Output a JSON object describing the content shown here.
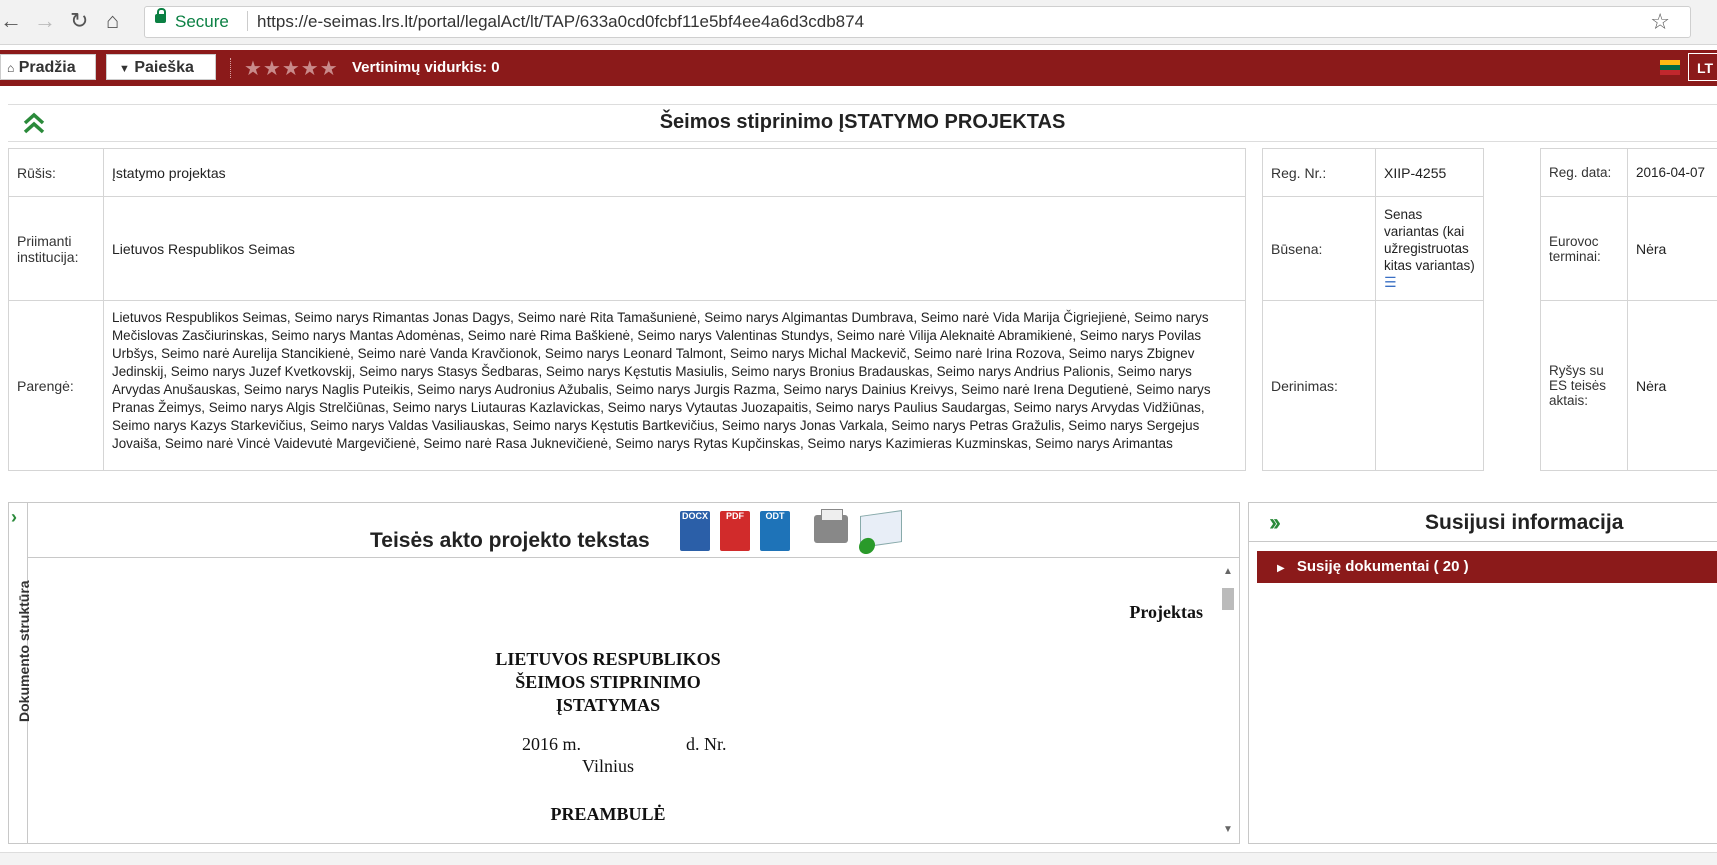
{
  "browser": {
    "secure_label": "Secure",
    "url": "https://e-seimas.lrs.lt/portal/legalAct/lt/TAP/633a0cd0fcbf11e5bf4ee4a6d3cdb874"
  },
  "toolbar": {
    "home_label": "Pradžia",
    "search_label": "Paieška",
    "rating_label": "Vertinimų vidurkis: 0",
    "lang": "LT"
  },
  "page": {
    "title": "Šeimos stiprinimo ĮSTATYMO PROJEKTAS"
  },
  "info": {
    "rusis_label": "Rūšis:",
    "rusis_value": "Įstatymo projektas",
    "priimanti_label": "Priimanti institucija:",
    "priimanti_value": "Lietuvos Respublikos Seimas",
    "parenge_label": "Parengė:",
    "parenge_value": "Lietuvos Respublikos Seimas, Seimo narys Rimantas Jonas Dagys, Seimo narė Rita Tamašunienė, Seimo narys Algimantas Dumbrava, Seimo narė Vida Marija Čigriejienė, Seimo narys Mečislovas Zasčiurinskas, Seimo narys Mantas Adomėnas, Seimo narė Rima Baškienė, Seimo narys Valentinas Stundys, Seimo narė Vilija Aleknaitė Abramikienė, Seimo narys Povilas Urbšys, Seimo narė Aurelija Stancikienė, Seimo narė Vanda Kravčionok, Seimo narys Leonard Talmont, Seimo narys Michal Mackevič, Seimo narė Irina Rozova, Seimo narys Zbignev Jedinskij, Seimo narys Juzef Kvetkovskij, Seimo narys Stasys Šedbaras, Seimo narys Kęstutis Masiulis, Seimo narys Bronius Bradauskas, Seimo narys Andrius Palionis, Seimo narys Arvydas Anušauskas, Seimo narys Naglis Puteikis, Seimo narys Audronius Ažubalis, Seimo narys Jurgis Razma, Seimo narys Dainius Kreivys, Seimo narė Irena Degutienė, Seimo narys Pranas Žeimys, Seimo narys Algis Strelčiūnas, Seimo narys Liutauras Kazlavickas, Seimo narys Vytautas Juozapaitis, Seimo narys Paulius Saudargas, Seimo narys Arvydas Vidžiūnas, Seimo narys Kazys Starkevičius, Seimo narys Valdas Vasiliauskas, Seimo narys Kęstutis Bartkevičius, Seimo narys Jonas Varkala, Seimo narys Petras Gražulis, Seimo narys Sergejus Jovaiša, Seimo narė Vincė Vaidevutė Margevičienė, Seimo narė Rasa Juknevičienė, Seimo narys Rytas Kupčinskas, Seimo narys Kazimieras Kuzminskas, Seimo narys Arimantas",
    "reg_nr_label": "Reg. Nr.:",
    "reg_nr_value": "XIIP-4255",
    "busena_label": "Būsena:",
    "busena_value": "Senas variantas (kai užregistruotas kitas variantas)",
    "derinimas_label": "Derinimas:",
    "reg_data_label": "Reg. data:",
    "reg_data_value": "2016-04-07",
    "eurovoc_label": "Eurovoc terminai:",
    "eurovoc_value": "Nėra",
    "rysys_label": "Ryšys su ES teisės aktais:",
    "rysys_value": "Nėra"
  },
  "doc": {
    "side_label": "Dokumento struktūra",
    "title": "Teisės akto projekto tekstas",
    "formats": [
      "DOCX",
      "PDF",
      "ODT"
    ],
    "projektas": "Projektas",
    "heading1": "LIETUVOS RESPUBLIKOS",
    "heading2": "ŠEIMOS STIPRINIMO",
    "heading3": "ĮSTATYMAS",
    "date_year": "2016 m.",
    "date_nr": "d. Nr.",
    "city": "Vilnius",
    "preamble": "PREAMBULĖ"
  },
  "related": {
    "title": "Susijusi informacija",
    "documents_label": "Susiję dokumentai ( 20 )"
  },
  "colors": {
    "brand_red": "#8b1a1a",
    "secure_green": "#0b8043",
    "arrow_green": "#2a8a3a"
  }
}
